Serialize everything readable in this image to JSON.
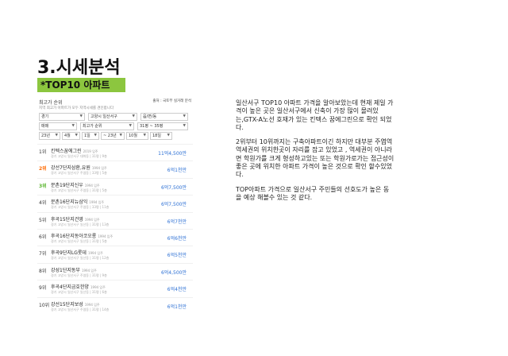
{
  "slide": {
    "title": "3.시세분석",
    "banner": "*TOP10 아파트"
  },
  "panel": {
    "title": "최고가 순위",
    "source": "출처 : 국토부 실거래 분석",
    "subtitle": "지역 최고가 아파트가 모두 지역시세를 견인합니다",
    "filters": [
      "경기",
      "고양시 일산서구",
      "읍/면/동",
      "매매",
      "최고가 순위",
      "31평 ~ 35평",
      "23년",
      "4월",
      "1일",
      "~ 23년",
      "10월",
      "18일"
    ],
    "items": [
      {
        "rank": "1위",
        "name": "킨텍스꿈에그린",
        "year": "2019 입주",
        "sub": "경기 고양시 일산서구 대화동 | 31평 | 9층",
        "price": "11억4,500만"
      },
      {
        "rank": "2위",
        "name": "강선7단지삼환,유원",
        "year": "1994 입주",
        "sub": "경기 고양시 일산서구 주엽동 | 33평 | 5층",
        "price": "6억1천만"
      },
      {
        "rank": "3위",
        "name": "문촌19단지신우",
        "year": "1994 입주",
        "sub": "경기 고양시 일산서구 주엽동 | 31평 | 5층",
        "price": "6억7,500만"
      },
      {
        "rank": "4위",
        "name": "문촌16단지뉴삼익",
        "year": "1994 입주",
        "sub": "경기 고양시 일산서구 주엽동 | 33평 | 11층",
        "price": "6억7,500만"
      },
      {
        "rank": "5위",
        "name": "후곡15단지건영",
        "year": "1994 입주",
        "sub": "경기 고양시 일산서구 일산동 | 31평 | 13층",
        "price": "6억7천만"
      },
      {
        "rank": "6위",
        "name": "후곡16단지동아코오롱",
        "year": "1994 입주",
        "sub": "경기 고양시 일산서구 일산동 | 31평 | 5층",
        "price": "6억6천만"
      },
      {
        "rank": "7위",
        "name": "후곡9단지LG롯데",
        "year": "1994 입주",
        "sub": "경기 고양시 일산서구 일산동 | 31평 | 12층",
        "price": "6억5천만"
      },
      {
        "rank": "8위",
        "name": "강성1단지동부",
        "year": "1994 입주",
        "sub": "경기 고양시 일산서구 주엽동 | 31평 | 9층",
        "price": "6억4,500만"
      },
      {
        "rank": "9위",
        "name": "후곡4단지금호한양",
        "year": "1994 입주",
        "sub": "경기 고양시 일산서구 일산동 | 31평 | 6층",
        "price": "6억4천만"
      },
      {
        "rank": "10위",
        "name": "강선15단지보성",
        "year": "1994 입주",
        "sub": "경기 고양시 일산서구 주엽동 | 31평 | 14층",
        "price": "6억1천만"
      }
    ]
  },
  "description": {
    "paragraphs": [
      "일산서구 TOP10 아파트 가격을 알아보았는데 현재 제일 가격이 높은 곳은 일산서구에서 신축이 가장 많이 몰려있는,GTX-A노선 호재가 있는 킨텍스 꿈에그린으로 확인 되었다.",
      "2위부터 10위까지는 구축아파트이긴 하지만 대부분 주엽역 역세권의 위치한곳이 자리를 잡고 있었고 , 역세권이 아니라면 학원가를 크게 형성하고있는 또는 학원가로가는 접근성이 좋은 곳에 위치한 아파트 가격이 높은 것으로 확인 할수있었다.",
      "TOP아파트 가격으로 일산서구 주민들의 선호도가 높은 동을 예상 해볼수 있는 것 같다."
    ]
  }
}
